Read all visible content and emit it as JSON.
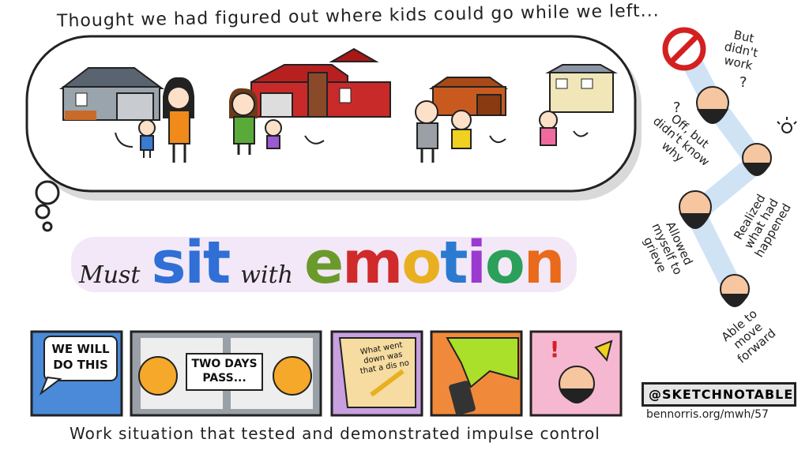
{
  "top_caption": "Thought we had figured out where kids could go while we left...",
  "bottom_caption": "Work situation that tested and demonstrated impulse control",
  "heading": {
    "word1": "Must",
    "word2": "sit",
    "word3": "with",
    "word4": "emotion",
    "emotion_letters": [
      {
        "ch": "e",
        "color": "#6a9a2c"
      },
      {
        "ch": "m",
        "color": "#d02a2a"
      },
      {
        "ch": "o",
        "color": "#e8b020"
      },
      {
        "ch": "t",
        "color": "#2a7ad0"
      },
      {
        "ch": "i",
        "color": "#9a3ad0"
      },
      {
        "ch": "o",
        "color": "#2aa05a"
      },
      {
        "ch": "n",
        "color": "#e86a1a"
      }
    ],
    "sit_color": "#2f6fd6"
  },
  "journey": {
    "step1": "But didn't work",
    "step2": "Off, but didn't know why",
    "step3": "Realized what had happened",
    "step4": "Allowed myself to grieve",
    "step5": "Able to move forward",
    "question_mark": "?"
  },
  "comic": {
    "panel1_text": "WE WILL DO THIS",
    "panel2_text": "TWO DAYS PASS...",
    "panel3_text": "What went down was that a dis no",
    "panel5_mark": "!"
  },
  "brand": {
    "handle": "@SKETCHNOTABLE",
    "url": "bennorris.org/mwh/57"
  },
  "colors": {
    "no_sign": "#d42020",
    "path": "#cfe3f5",
    "thought_shadow": "#d8d8d8"
  }
}
